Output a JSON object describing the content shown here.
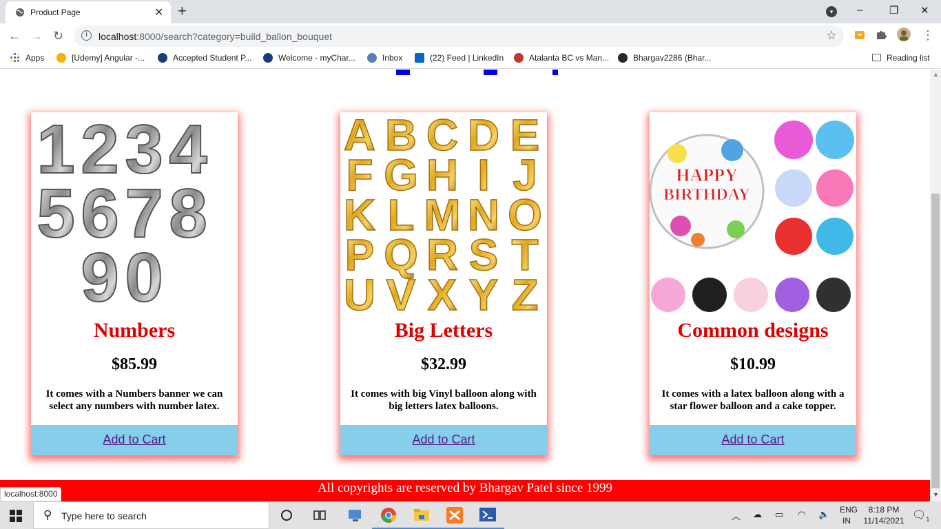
{
  "browser": {
    "tab_title": "Product Page",
    "tab_close": "✕",
    "new_tab": "+",
    "window_controls": {
      "minimize": "–",
      "restore": "❐",
      "close": "✕"
    },
    "url_host": "localhost",
    "url_rest": ":8000/search?category=build_ballon_bouquet",
    "bookmarks": [
      {
        "label": "Apps",
        "icon": "apps-grid-icon",
        "color": "#ea4335"
      },
      {
        "label": "[Udemy] Angular -...",
        "icon": "udemy-icon",
        "color": "#f4b400"
      },
      {
        "label": "Accepted Student P...",
        "icon": "student-portal-icon",
        "color": "#1a3d7c"
      },
      {
        "label": "Welcome - myChar...",
        "icon": "mychar-icon",
        "color": "#1a3d7c"
      },
      {
        "label": "Inbox",
        "icon": "inbox-icon",
        "color": "#5a7fb8"
      },
      {
        "label": "(22) Feed | LinkedIn",
        "icon": "linkedin-icon",
        "color": "#0a66c2"
      },
      {
        "label": "Atalanta BC vs Man...",
        "icon": "soccer-icon",
        "color": "#c0392b"
      },
      {
        "label": "Bhargav2286 (Bhar...",
        "icon": "github-icon",
        "color": "#24292e"
      }
    ],
    "reading_list": "Reading list"
  },
  "products": [
    {
      "name": "Numbers",
      "price": "$85.99",
      "description": "It comes with a Numbers banner we can select any numbers with number latex.",
      "cart_label": "Add to Cart",
      "image_glyphs": [
        "1",
        "2",
        "3",
        "4",
        "5",
        "6",
        "7",
        "8",
        "9",
        "0"
      ]
    },
    {
      "name": "Big Letters",
      "price": "$32.99",
      "description": "It comes with big Vinyl balloon along with big letters latex balloons.",
      "cart_label": "Add to Cart",
      "image_glyphs": [
        "A",
        "B",
        "C",
        "D",
        "E",
        "F",
        "G",
        "H",
        "I",
        "J",
        "K",
        "L",
        "M",
        "N",
        "O",
        "P",
        "Q",
        "R",
        "S",
        "T",
        "U",
        "V",
        "X",
        "Y",
        "Z"
      ]
    },
    {
      "name": "Common designs",
      "price": "$10.99",
      "description": "It comes with a latex balloon along with a star flower balloon and a cake topper.",
      "cart_label": "Add to Cart",
      "image_text": [
        "HAPPY",
        "BIRTHDAY"
      ]
    }
  ],
  "footer": "All copyrights are reserved by Bhargav Patel since 1999",
  "status_bar": "localhost:8000",
  "taskbar": {
    "search_placeholder": "Type here to search",
    "lang_top": "ENG",
    "lang_bottom": "IN",
    "time": "8:18 PM",
    "date": "11/14/2021",
    "notification_count": "1"
  },
  "colors": {
    "accent_red": "#ff0000",
    "product_name": "#e00000",
    "cart_bg": "#87ceeb",
    "link": "#551a8b"
  }
}
